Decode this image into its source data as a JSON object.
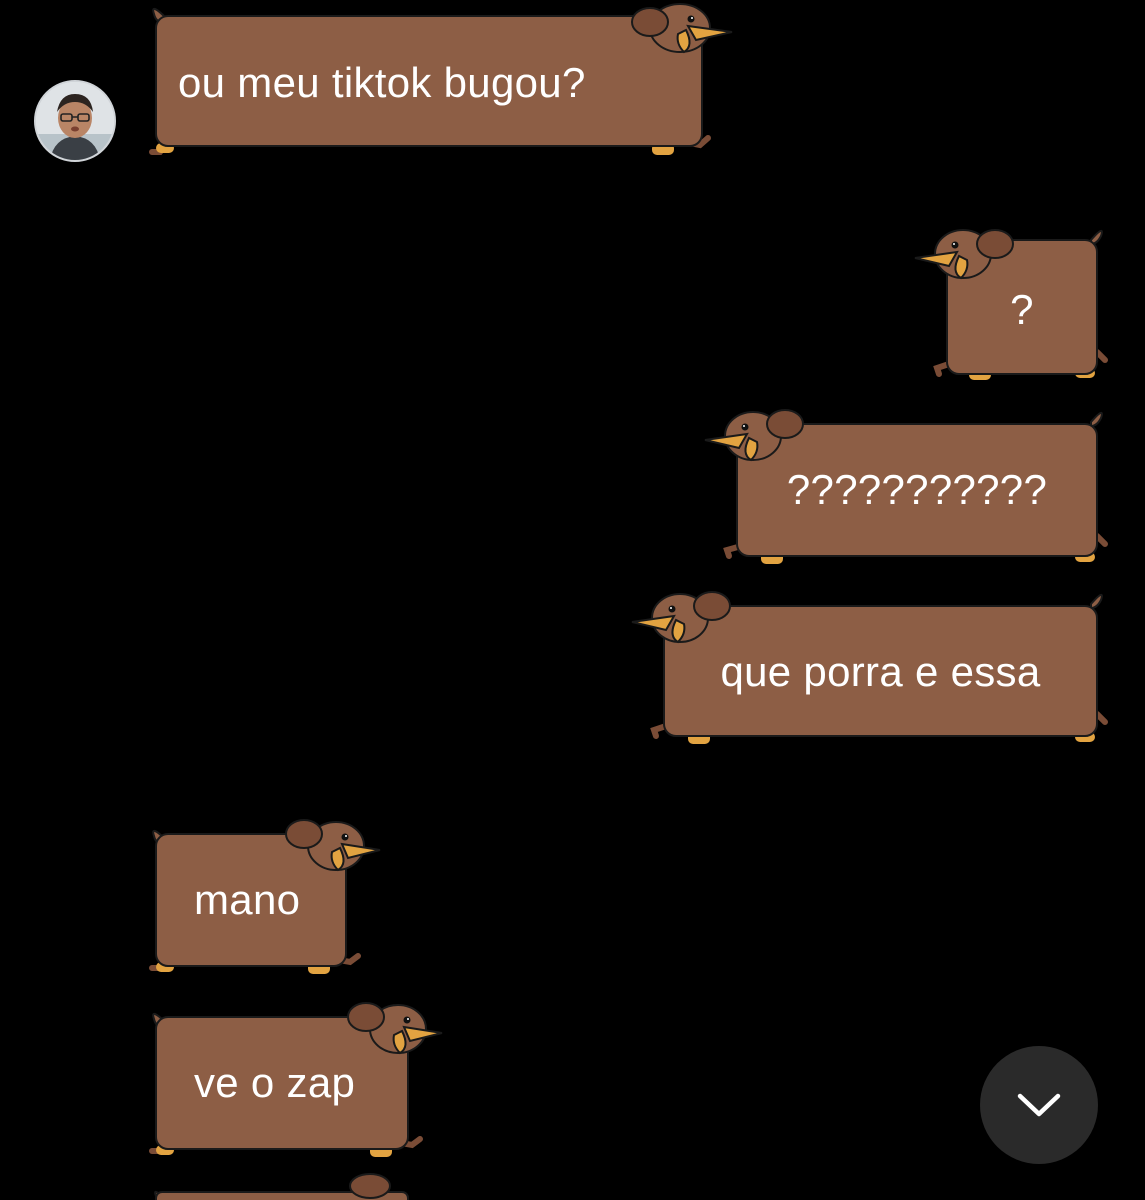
{
  "conversation": {
    "messages": [
      {
        "id": "m1",
        "direction": "incoming",
        "text": "ou meu tiktok bugou?"
      },
      {
        "id": "m2",
        "direction": "outgoing",
        "text": "?"
      },
      {
        "id": "m3",
        "direction": "outgoing",
        "text": "???????????"
      },
      {
        "id": "m4",
        "direction": "outgoing",
        "text": "que porra e essa"
      },
      {
        "id": "m5",
        "direction": "incoming",
        "text": "mano"
      },
      {
        "id": "m6",
        "direction": "incoming",
        "text": "ve o zap"
      }
    ]
  },
  "bubble_style": {
    "theme": "dachshund",
    "body_color": "#8d5e45",
    "ear_color": "#7a4c36",
    "snout_color": "#e2a341",
    "paw_color": "#e2a341",
    "outline_color": "#1a1a1a",
    "text_color": "#ffffff",
    "background": "#000000"
  },
  "avatar": {
    "icon": "user-avatar-photo"
  },
  "scroll_button": {
    "icon": "chevron-down-icon",
    "background": "#2a2a2a"
  }
}
